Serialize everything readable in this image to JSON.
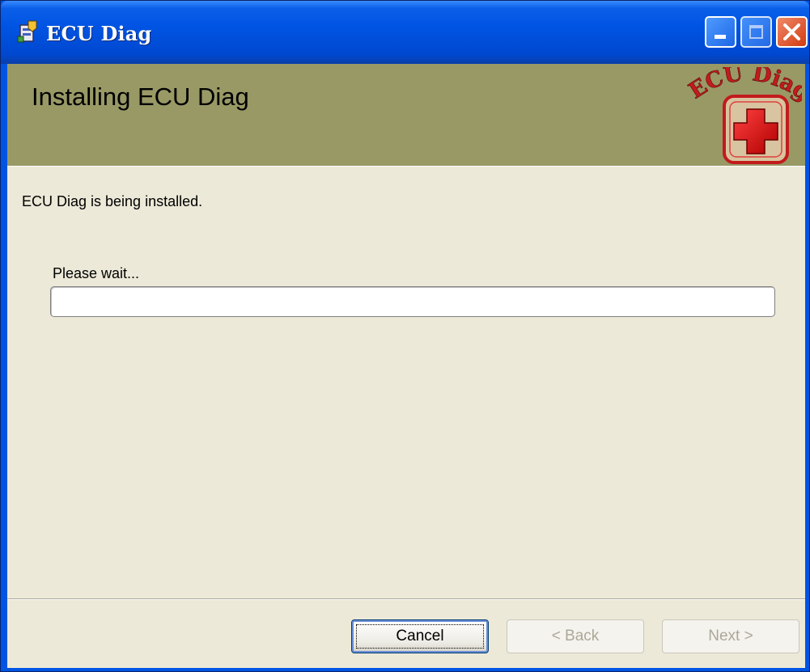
{
  "window": {
    "title": "ECU Diag",
    "title_icon": "installer-icon",
    "controls": [
      "minimize-icon",
      "maximize-icon",
      "close-icon"
    ]
  },
  "banner": {
    "heading": "Installing ECU Diag",
    "logo_text": "ECU Diag",
    "logo_icon": "red-cross-icon",
    "background_color": "#999966"
  },
  "content": {
    "description": "ECU Diag is being installed.",
    "status": "Please wait...",
    "progress": 0
  },
  "buttons": {
    "cancel": "Cancel",
    "back": "< Back",
    "next": "Next >",
    "back_enabled": false,
    "next_enabled": false
  }
}
